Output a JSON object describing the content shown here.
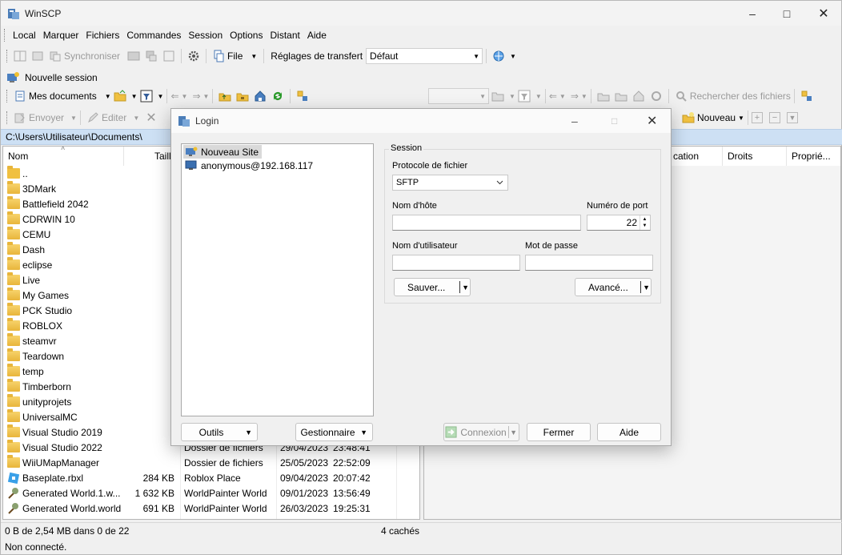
{
  "app": {
    "title": "WinSCP"
  },
  "menu": [
    "Local",
    "Marquer",
    "Fichiers",
    "Commandes",
    "Session",
    "Options",
    "Distant",
    "Aide"
  ],
  "toolbar": {
    "synchroniser": "Synchroniser",
    "file": "File",
    "transfer_label": "Réglages de transfert",
    "transfer_value": "Défaut"
  },
  "new_session": "Nouvelle session",
  "local": {
    "location": "Mes documents",
    "envoyer": "Envoyer",
    "editer": "Editer",
    "path": "C:\\Users\\Utilisateur\\Documents\\"
  },
  "remote": {
    "search": "Rechercher des fichiers",
    "nouveau": "Nouveau",
    "headers": [
      "cation",
      "Droits",
      "Proprié..."
    ]
  },
  "columns": {
    "name": "Nom",
    "size": "Taille"
  },
  "folders": [
    "..",
    "3DMark",
    "Battlefield 2042",
    "CDRWIN 10",
    "CEMU",
    "Dash",
    "eclipse",
    "Live",
    "My Games",
    "PCK Studio",
    "ROBLOX",
    "steamvr",
    "Teardown",
    "temp",
    "Timberborn",
    "unityprojets",
    "UniversalMC",
    "Visual Studio 2019",
    "Visual Studio 2022",
    "WiiUMapManager"
  ],
  "files": [
    {
      "name": "Baseplate.rbxl",
      "size": "284 KB",
      "type": "Roblox Place",
      "date": "09/04/2023",
      "time": "20:07:42"
    },
    {
      "name": "Generated World.1.w...",
      "size": "1 632 KB",
      "type": "WorldPainter World",
      "date": "09/01/2023",
      "time": "13:56:49"
    },
    {
      "name": "Generated World.world",
      "size": "691 KB",
      "type": "WorldPainter World",
      "date": "26/03/2023",
      "time": "19:25:31"
    }
  ],
  "folder_rows_visible": [
    {
      "type": "Dossier de fichiers",
      "date": "29/04/2023",
      "time": "23:48:41"
    },
    {
      "type": "Dossier de fichiers",
      "date": "25/05/2023",
      "time": "22:52:09"
    }
  ],
  "status": {
    "selection": "0 B de 2,54 MB dans 0 de 22",
    "hidden": "4 cachés",
    "connection": "Non connecté."
  },
  "login": {
    "title": "Login",
    "sites": [
      "Nouveau Site",
      "anonymous@192.168.117"
    ],
    "session_group": "Session",
    "protocol_label": "Protocole de fichier",
    "protocol_value": "SFTP",
    "host_label": "Nom d'hôte",
    "host_value": "",
    "port_label": "Numéro de port",
    "port_value": "22",
    "user_label": "Nom d'utilisateur",
    "user_value": "",
    "pass_label": "Mot de passe",
    "pass_value": "",
    "save": "Sauver...",
    "advanced": "Avancé...",
    "tools": "Outils",
    "manager": "Gestionnaire",
    "connect": "Connexion",
    "close": "Fermer",
    "help": "Aide"
  },
  "colors": {
    "path_bg": "#cde0f4",
    "selected_site": "#d9d9d9",
    "accent": "#0067c0"
  }
}
